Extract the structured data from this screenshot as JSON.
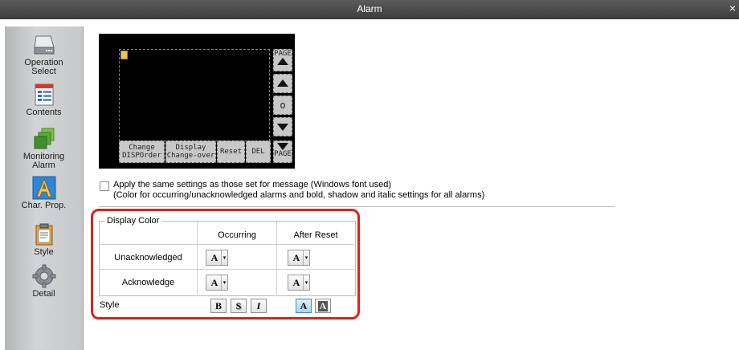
{
  "window": {
    "title": "Alarm",
    "close_glyph": "×"
  },
  "sidebar": {
    "items": [
      {
        "label_line1": "Operation",
        "label_line2": "Select",
        "icon": "drive-icon"
      },
      {
        "label_line1": "Contents",
        "label_line2": "",
        "icon": "contents-list-icon"
      },
      {
        "label_line1": "Monitoring",
        "label_line2": "Alarm",
        "icon": "monitoring-icon"
      },
      {
        "label_line1": "Char. Prop.",
        "label_line2": "",
        "icon": "char-prop-icon",
        "selected": true
      },
      {
        "label_line1": "Style",
        "label_line2": "",
        "icon": "style-clipboard-icon"
      },
      {
        "label_line1": "Detail",
        "label_line2": "",
        "icon": "gear-icon"
      }
    ]
  },
  "preview": {
    "side_buttons": {
      "page_up": "PAGE",
      "center": "o",
      "page_down": "PAGE"
    },
    "bottom_buttons": {
      "change_order_1": "Change",
      "change_order_2": "DISPOrder",
      "display_1": "Display",
      "display_2": "Change-over",
      "reset": "Reset",
      "del": "DEL"
    }
  },
  "apply_setting": {
    "checked": false,
    "line1": "Apply the same settings as those set for message (Windows font used)",
    "line2": "(Color for occurring/unacknowledged alarms and bold, shadow and italic settings for all alarms)"
  },
  "display_color": {
    "group_label": "Display Color",
    "col_occurring": "Occurring",
    "col_after_reset": "After Reset",
    "row_unack": "Unacknowledged",
    "row_ack": "Acknowledge",
    "button_letter": "A",
    "dropdown_glyph": "▾"
  },
  "style": {
    "label": "Style",
    "bold": "B",
    "shadow": "S",
    "italic": "I",
    "normal": "A",
    "outline": "A",
    "active": "normal"
  },
  "colors": {
    "highlight": "#e0201b",
    "accent": "#3a8fc6"
  }
}
